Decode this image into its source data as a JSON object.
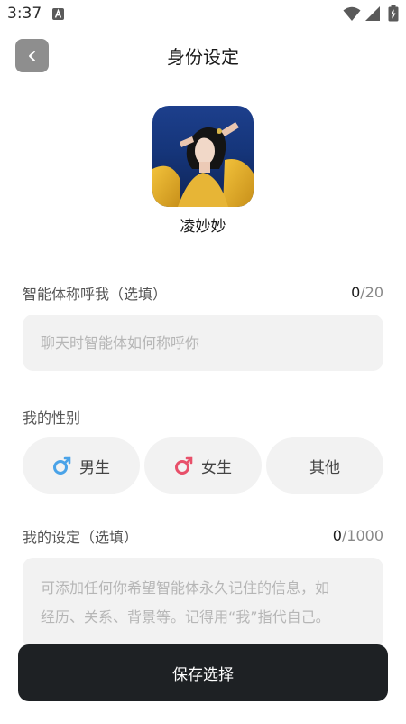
{
  "status_bar": {
    "time": "3:37"
  },
  "header": {
    "title": "身份设定"
  },
  "profile": {
    "name": "凌妙妙"
  },
  "nickname": {
    "label": "智能体称呼我（选填）",
    "count": "0",
    "max": "/20",
    "placeholder": "聊天时智能体如何称呼你",
    "value": ""
  },
  "gender": {
    "label": "我的性别",
    "options": [
      {
        "label": "男生",
        "icon": "male-icon",
        "color": "#4aa3e8"
      },
      {
        "label": "女生",
        "icon": "female-icon",
        "color": "#e8506a"
      },
      {
        "label": "其他",
        "icon": ""
      }
    ]
  },
  "setting": {
    "label": "我的设定（选填）",
    "count": "0",
    "max": "/1000",
    "placeholder_lines": [
      "可添加任何你希望智能体永久记住的信息，如",
      "经历、关系、背景等。记得用“我”指代自己。"
    ]
  },
  "footer": {
    "save_label": "保存选择"
  },
  "colors": {
    "primary_button": "#1e2124",
    "input_bg": "#f2f2f2",
    "back_button": "#8e8e8e"
  }
}
